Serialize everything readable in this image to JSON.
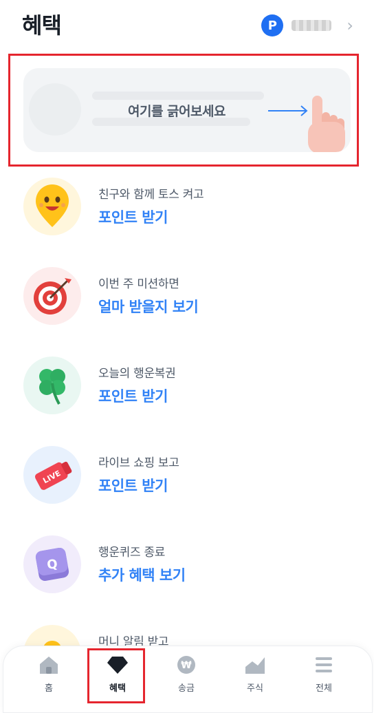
{
  "header": {
    "title": "혜택",
    "profile_badge": "P",
    "chevron": "›"
  },
  "scratch": {
    "text": "여기를 긁어보세요"
  },
  "items": [
    {
      "subtitle": "친구와 함께 토스 켜고",
      "action": "포인트 받기",
      "icon": "smiley-face-icon",
      "bg": "#fff6dc"
    },
    {
      "subtitle": "이번 주 미션하면",
      "action": "얼마 받을지 보기",
      "icon": "target-dart-icon",
      "bg": "#fdecec"
    },
    {
      "subtitle": "오늘의 행운복권",
      "action": "포인트 받기",
      "icon": "clover-icon",
      "bg": "#e9f7f2"
    },
    {
      "subtitle": "라이브 쇼핑 보고",
      "action": "포인트 받기",
      "icon": "live-tag-icon",
      "icon_text": "LIVE",
      "bg": "#e8f1fd"
    },
    {
      "subtitle": "행운퀴즈 종료",
      "action": "추가 혜택 보기",
      "icon": "quiz-q-icon",
      "icon_text": "Q",
      "bg": "#f1ecfb"
    },
    {
      "subtitle": "머니 알림 받고",
      "action": "",
      "icon": "bell-icon",
      "bg": "#fff6dc"
    }
  ],
  "tabs": [
    {
      "label": "홈",
      "icon": "home-icon"
    },
    {
      "label": "혜택",
      "icon": "gem-icon",
      "active": true
    },
    {
      "label": "송금",
      "icon": "won-coin-icon"
    },
    {
      "label": "주식",
      "icon": "stock-chart-icon"
    },
    {
      "label": "전체",
      "icon": "menu-icon"
    }
  ],
  "colors": {
    "accent": "#3182f6",
    "highlight": "#e5252e",
    "badge": "#1f6ff2"
  }
}
